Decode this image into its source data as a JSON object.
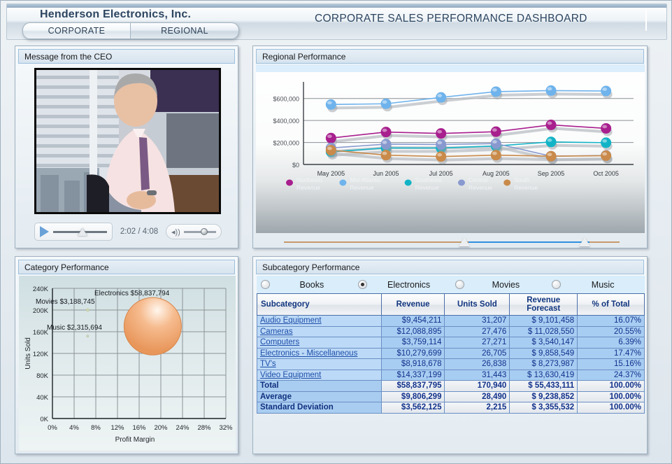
{
  "header": {
    "company": "Henderson Electronics, Inc.",
    "dashboard_title": "CORPORATE SALES PERFORMANCE DASHBOARD",
    "tabs": [
      {
        "label": "CORPORATE"
      },
      {
        "label": "REGIONAL"
      }
    ]
  },
  "ceo_panel": {
    "title": "Message from the CEO",
    "play_icon": "play-icon",
    "time": "2:02 / 4:08",
    "volume_icon": "speaker-icon"
  },
  "regional_panel": {
    "title": "Regional Performance"
  },
  "category_panel": {
    "title": "Category Performance"
  },
  "subcategory_panel": {
    "title": "Subcategory Performance",
    "radios": [
      {
        "label": "Books",
        "selected": false
      },
      {
        "label": "Electronics",
        "selected": true
      },
      {
        "label": "Movies",
        "selected": false
      },
      {
        "label": "Music",
        "selected": false
      }
    ],
    "columns": [
      "Subcategory",
      "Revenue",
      "Units Sold",
      "Revenue Forecast",
      "% of Total"
    ],
    "rows": [
      {
        "name": "Audio Equipment",
        "revenue": "$9,454,211",
        "units": "31,207",
        "forecast": "$ 9,101,458",
        "pct": "16.07%",
        "type": "data"
      },
      {
        "name": "Cameras",
        "revenue": "$12,088,895",
        "units": "27,476",
        "forecast": "$ 11,028,550",
        "pct": "20.55%",
        "type": "data"
      },
      {
        "name": "Computers",
        "revenue": "$3,759,114",
        "units": "27,271",
        "forecast": "$ 3,540,147",
        "pct": "6.39%",
        "type": "data"
      },
      {
        "name": "Electronics - Miscellaneous",
        "revenue": "$10,279,699",
        "units": "26,705",
        "forecast": "$ 9,858,549",
        "pct": "17.47%",
        "type": "data"
      },
      {
        "name": "TV's",
        "revenue": "$8,918,678",
        "units": "26,838",
        "forecast": "$ 8,273,987",
        "pct": "15.16%",
        "type": "data"
      },
      {
        "name": "Video Equipment",
        "revenue": "$14,337,199",
        "units": "31,443",
        "forecast": "$ 13,630,419",
        "pct": "24.37%",
        "type": "data"
      },
      {
        "name": "Total",
        "revenue": "$58,837,795",
        "units": "170,940",
        "forecast": "$ 55,433,111",
        "pct": "100.00%",
        "type": "summary"
      },
      {
        "name": "Average",
        "revenue": "$9,806,299",
        "units": "28,490",
        "forecast": "$ 9,238,852",
        "pct": "100.00%",
        "type": "summary"
      },
      {
        "name": "Standard Deviation",
        "revenue": "$3,562,125",
        "units": "2,215",
        "forecast": "$ 3,355,532",
        "pct": "100.00%",
        "type": "summary"
      }
    ]
  },
  "chart_data": [
    {
      "id": "regional-line-chart",
      "type": "line",
      "title": "Regional Performance",
      "xlabel": "",
      "ylabel": "",
      "categories": [
        "May 2005",
        "Jun 2005",
        "Jul 2005",
        "Aug 2005",
        "Sep 2005",
        "Oct 2005"
      ],
      "yticks": [
        "$0",
        "$200,000",
        "$400,000",
        "$600,000"
      ],
      "ylim": [
        0,
        700000
      ],
      "grid": true,
      "legend_position": "bottom",
      "series": [
        {
          "name": "Northeast Revenue",
          "color": "#a81f8e",
          "values": [
            240000,
            295000,
            282000,
            298000,
            360000,
            328000
          ]
        },
        {
          "name": "Mid-Atlantic Revenue",
          "color": "#6fb3ec",
          "values": [
            545000,
            552000,
            610000,
            662000,
            672000,
            668000
          ]
        },
        {
          "name": "Southeast Revenue",
          "color": "#13b3c6",
          "values": [
            115000,
            150000,
            150000,
            168000,
            205000,
            198000
          ]
        },
        {
          "name": "Central Revenue",
          "color": "#8899cf",
          "values": [
            150000,
            185000,
            182000,
            190000,
            75000,
            82000
          ]
        },
        {
          "name": "South Revenue",
          "color": "#c98a4a",
          "values": [
            130000,
            85000,
            72000,
            85000,
            75000,
            80000
          ]
        }
      ]
    },
    {
      "id": "category-bubble-chart",
      "type": "scatter",
      "title": "Category Performance",
      "xlabel": "Profit Margin",
      "ylabel": "Units Sold",
      "xticks": [
        "0%",
        "4%",
        "8%",
        "12%",
        "16%",
        "20%",
        "24%",
        "28%",
        "32%"
      ],
      "yticks": [
        "0K",
        "40K",
        "80K",
        "120K",
        "160K",
        "200K",
        "240K"
      ],
      "xlim": [
        0,
        32
      ],
      "ylim": [
        0,
        240
      ],
      "grid": true,
      "bubbles": [
        {
          "label": "Electronics $58,837,794",
          "x": 18.5,
          "y": 170,
          "size": 82,
          "color": "#f0a868"
        },
        {
          "label": "Movies $3,188,745",
          "x": 6.5,
          "y": 200,
          "size": 4,
          "color": "#cfd9ad"
        },
        {
          "label": "Music $2,315,694",
          "x": 6.5,
          "y": 152,
          "size": 3,
          "color": "#cfd9c4"
        }
      ]
    }
  ]
}
